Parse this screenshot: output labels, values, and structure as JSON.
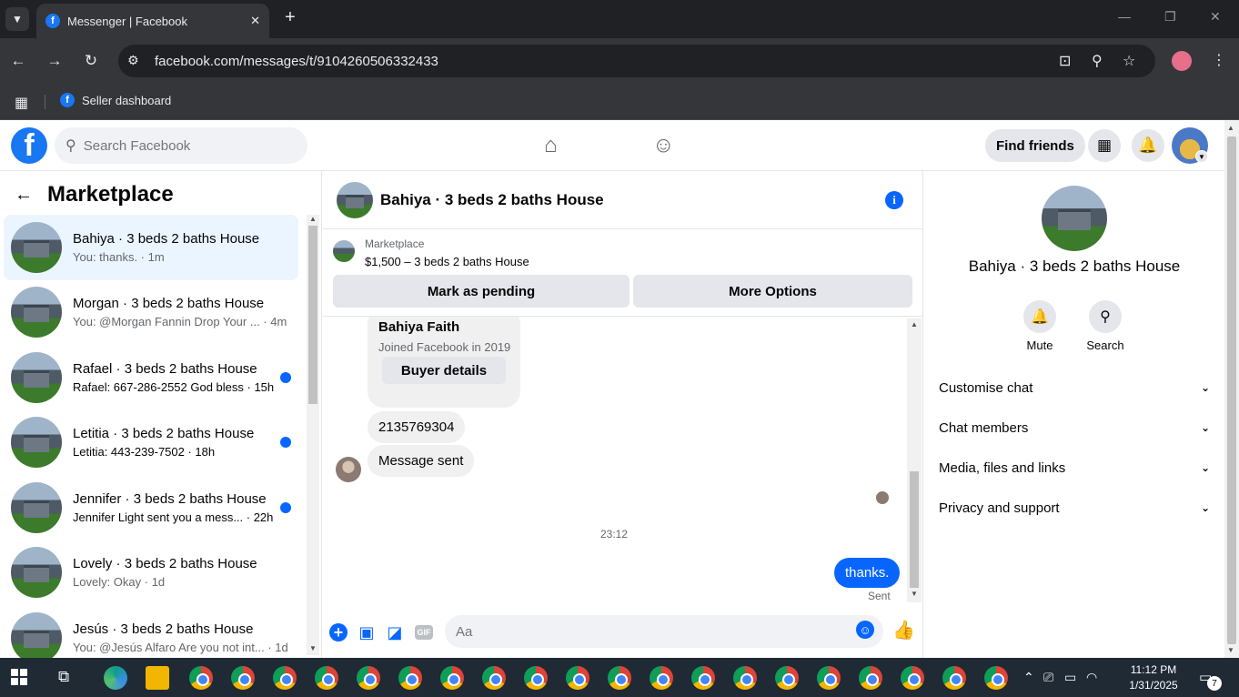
{
  "browser": {
    "tab_title": "Messenger | Facebook",
    "tab_favicon": "f",
    "url_host": "facebook.com",
    "url_path": "/messages/t/9104260506332433",
    "bookmark_label": "Seller dashboard",
    "bookmark_favicon": "f"
  },
  "fb_header": {
    "logo": "f",
    "search_placeholder": "Search Facebook",
    "find_friends": "Find friends"
  },
  "left_panel": {
    "title": "Marketplace",
    "conversations": [
      {
        "name": "Bahiya · 3 beds 2 baths House",
        "preview": "You: thanks. · 1m",
        "unread": false,
        "active": true
      },
      {
        "name": "Morgan · 3 beds 2 baths House",
        "preview": "You: @Morgan Fannin Drop Your ... · 4m",
        "unread": false,
        "active": false
      },
      {
        "name": "Rafael · 3 beds 2 baths House",
        "preview": "Rafael: 667-286-2552 God bless · 15h",
        "unread": true,
        "active": false
      },
      {
        "name": "Letitia · 3 beds 2 baths House",
        "preview": "Letitia: 443-239-7502 · 18h",
        "unread": true,
        "active": false
      },
      {
        "name": "Jennifer · 3 beds 2 baths House",
        "preview": "Jennifer Light sent you a mess... · 22h",
        "unread": true,
        "active": false
      },
      {
        "name": "Lovely · 3 beds 2 baths House",
        "preview": "Lovely: Okay · 1d",
        "unread": false,
        "active": false
      },
      {
        "name": "Jesús · 3 beds 2 baths House",
        "preview": "You: @Jesús Alfaro Are you not int... · 1d",
        "unread": false,
        "active": false
      }
    ]
  },
  "chat": {
    "title": "Bahiya · 3 beds 2 baths House",
    "info_icon": "i",
    "marketplace_label": "Marketplace",
    "listing": "$1,500 – 3 beds 2 baths House",
    "mark_pending": "Mark as pending",
    "more_options": "More Options",
    "buyer_card": {
      "name": "Bahiya Faith",
      "joined": "Joined Facebook in 2019",
      "button": "Buyer details"
    },
    "messages_in": [
      "2135769304",
      "Message sent"
    ],
    "timestamp": "23:12",
    "message_out": "thanks.",
    "sent_label": "Sent",
    "composer_placeholder": "Aa",
    "gif_label": "GIF"
  },
  "right_panel": {
    "name": "Bahiya · 3 beds 2 baths House",
    "actions": [
      {
        "label": "Mute",
        "icon": "bell-icon"
      },
      {
        "label": "Search",
        "icon": "search-icon"
      }
    ],
    "sections": [
      "Customise chat",
      "Chat members",
      "Media, files and links",
      "Privacy and support"
    ]
  },
  "taskbar": {
    "time": "11:12 PM",
    "date": "1/31/2025",
    "notification_count": "7"
  },
  "colors": {
    "fb_blue": "#1877f2",
    "messenger_blue": "#0866ff",
    "active_conv_bg": "#ebf5ff",
    "chrome_dark": "#35363a"
  }
}
